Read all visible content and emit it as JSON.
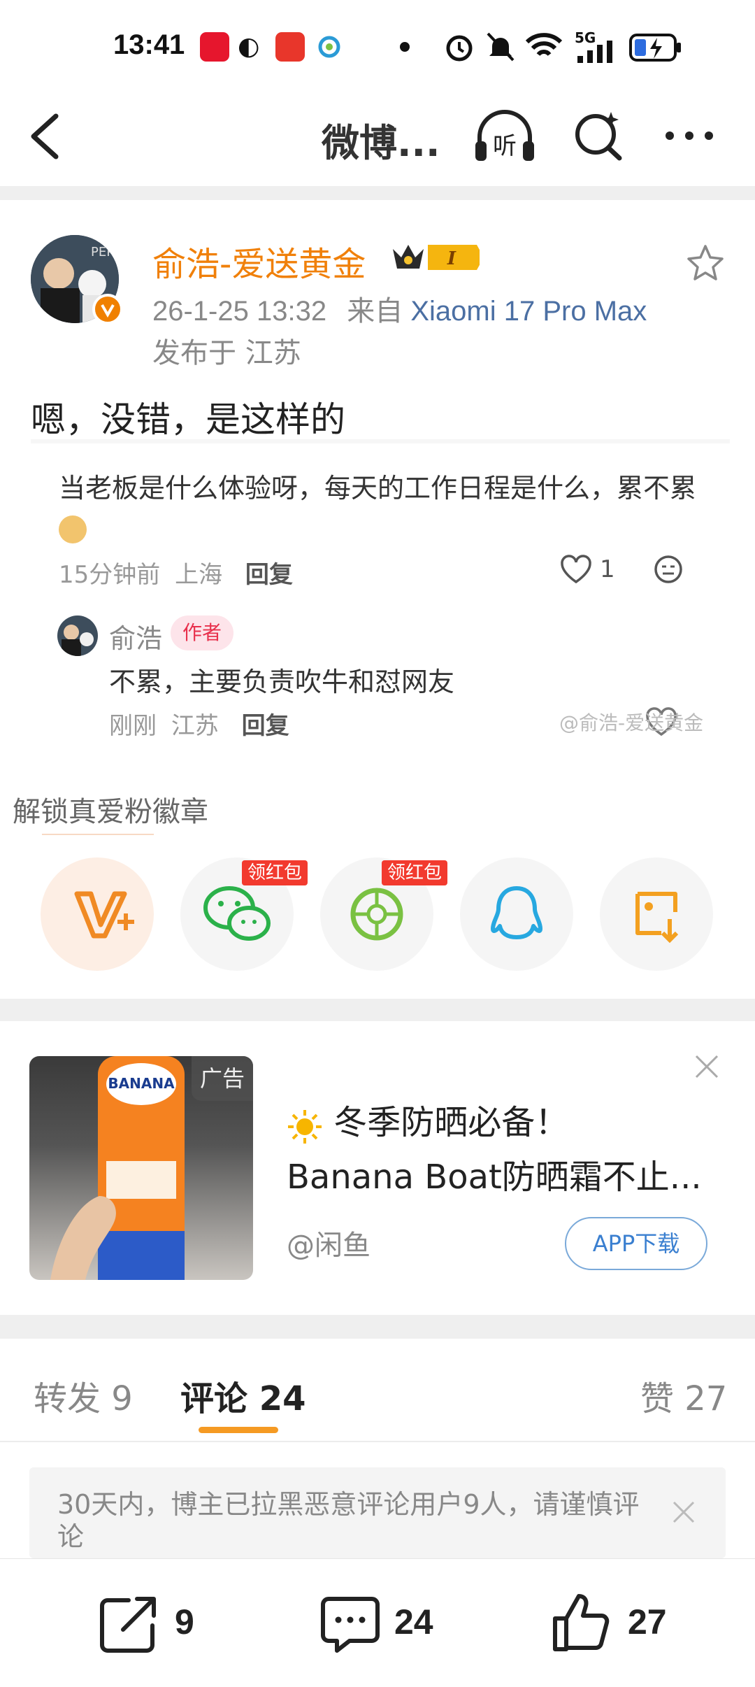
{
  "status_bar": {
    "time": "13:41",
    "network": "5G"
  },
  "nav": {
    "title": "微博..."
  },
  "post": {
    "username": "俞浩-爱送黄金",
    "member_badge": "I",
    "timestamp": "26-1-25 13:32",
    "source_prefix": "来自",
    "device": "Xiaomi 17 Pro Max",
    "location": "发布于 江苏",
    "text": "嗯，没错，是这样的"
  },
  "quoted_comment": {
    "text": "当老板是什么体验呀，每天的工作日程是什么，累不累",
    "time": "15分钟前",
    "location": "上海",
    "reply_label": "回复",
    "likes": "1"
  },
  "author_reply": {
    "name": "俞浩",
    "tag": "作者",
    "text": "不累，主要负责吹牛和怼网友",
    "time": "刚刚",
    "location": "江苏",
    "reply_label": "回复",
    "watermark": "@俞浩-爱送黄金"
  },
  "share": {
    "title": "解锁真爱粉徽章",
    "redpack_label": "领红包",
    "items": [
      "weibo-fan",
      "wechat",
      "moments",
      "qq",
      "save-image"
    ]
  },
  "ad": {
    "tag": "广告",
    "title_line1": "冬季防晒必备！",
    "title_line2": "Banana Boat防晒霜不止...",
    "source": "@闲鱼",
    "button": "APP下载"
  },
  "tabs": {
    "repost": "转发 9",
    "comment": "评论 24",
    "like": "赞 27"
  },
  "notice": {
    "text": "30天内，博主已拉黑恶意评论用户9人，请谨慎评论"
  },
  "bottom_bar": {
    "repost_count": "9",
    "comment_count": "24",
    "like_count": "27"
  },
  "colors": {
    "accent_orange": "#f0800a",
    "link_blue": "#4b6fa3",
    "tab_underline": "#f59a23",
    "redpack": "#f23a2e"
  }
}
